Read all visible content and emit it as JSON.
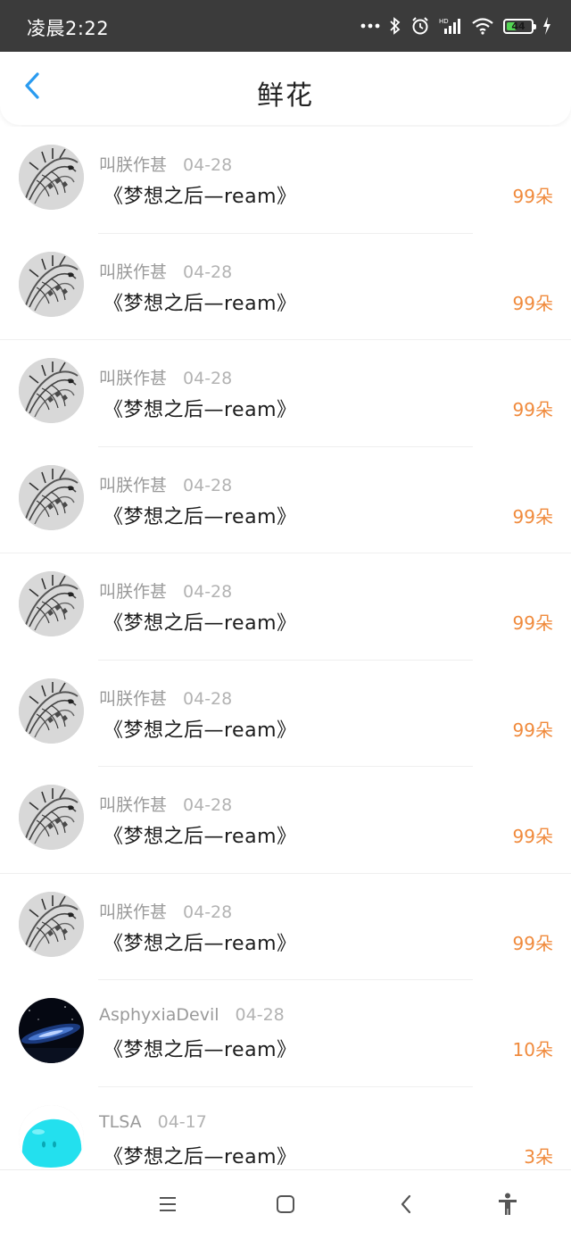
{
  "status_bar": {
    "time": "凌晨2:22",
    "icons": [
      "more-dots-icon",
      "bluetooth-icon",
      "alarm-icon",
      "hd-signal-icon",
      "wifi-icon",
      "battery-icon",
      "charging-icon"
    ],
    "battery_level": "44"
  },
  "header": {
    "title": "鲜花",
    "back_icon": "chevron-left-icon"
  },
  "list": {
    "items": [
      {
        "user": "叫朕作甚",
        "date": "04-28",
        "title": "《梦想之后—ream》",
        "count": "99朵",
        "avatar": "dragon-sketch"
      },
      {
        "user": "叫朕作甚",
        "date": "04-28",
        "title": "《梦想之后—ream》",
        "count": "99朵",
        "avatar": "dragon-sketch"
      },
      {
        "user": "叫朕作甚",
        "date": "04-28",
        "title": "《梦想之后—ream》",
        "count": "99朵",
        "avatar": "dragon-sketch"
      },
      {
        "user": "叫朕作甚",
        "date": "04-28",
        "title": "《梦想之后—ream》",
        "count": "99朵",
        "avatar": "dragon-sketch"
      },
      {
        "user": "叫朕作甚",
        "date": "04-28",
        "title": "《梦想之后—ream》",
        "count": "99朵",
        "avatar": "dragon-sketch"
      },
      {
        "user": "叫朕作甚",
        "date": "04-28",
        "title": "《梦想之后—ream》",
        "count": "99朵",
        "avatar": "dragon-sketch"
      },
      {
        "user": "叫朕作甚",
        "date": "04-28",
        "title": "《梦想之后—ream》",
        "count": "99朵",
        "avatar": "dragon-sketch"
      },
      {
        "user": "叫朕作甚",
        "date": "04-28",
        "title": "《梦想之后—ream》",
        "count": "99朵",
        "avatar": "dragon-sketch"
      },
      {
        "user": "AsphyxiaDevil",
        "date": "04-28",
        "title": "《梦想之后—ream》",
        "count": "10朵",
        "avatar": "galaxy"
      },
      {
        "user": "TLSA",
        "date": "04-17",
        "title": "《梦想之后—ream》",
        "count": "3朵",
        "avatar": "cyan-blob"
      }
    ]
  },
  "nav_bar": {
    "icons": [
      "menu-icon",
      "home-square-icon",
      "back-icon",
      "accessibility-icon"
    ]
  },
  "colors": {
    "accent_blue": "#2a9bf0",
    "count_orange": "#f08a3c",
    "status_bar_bg": "#3b3b3b"
  }
}
